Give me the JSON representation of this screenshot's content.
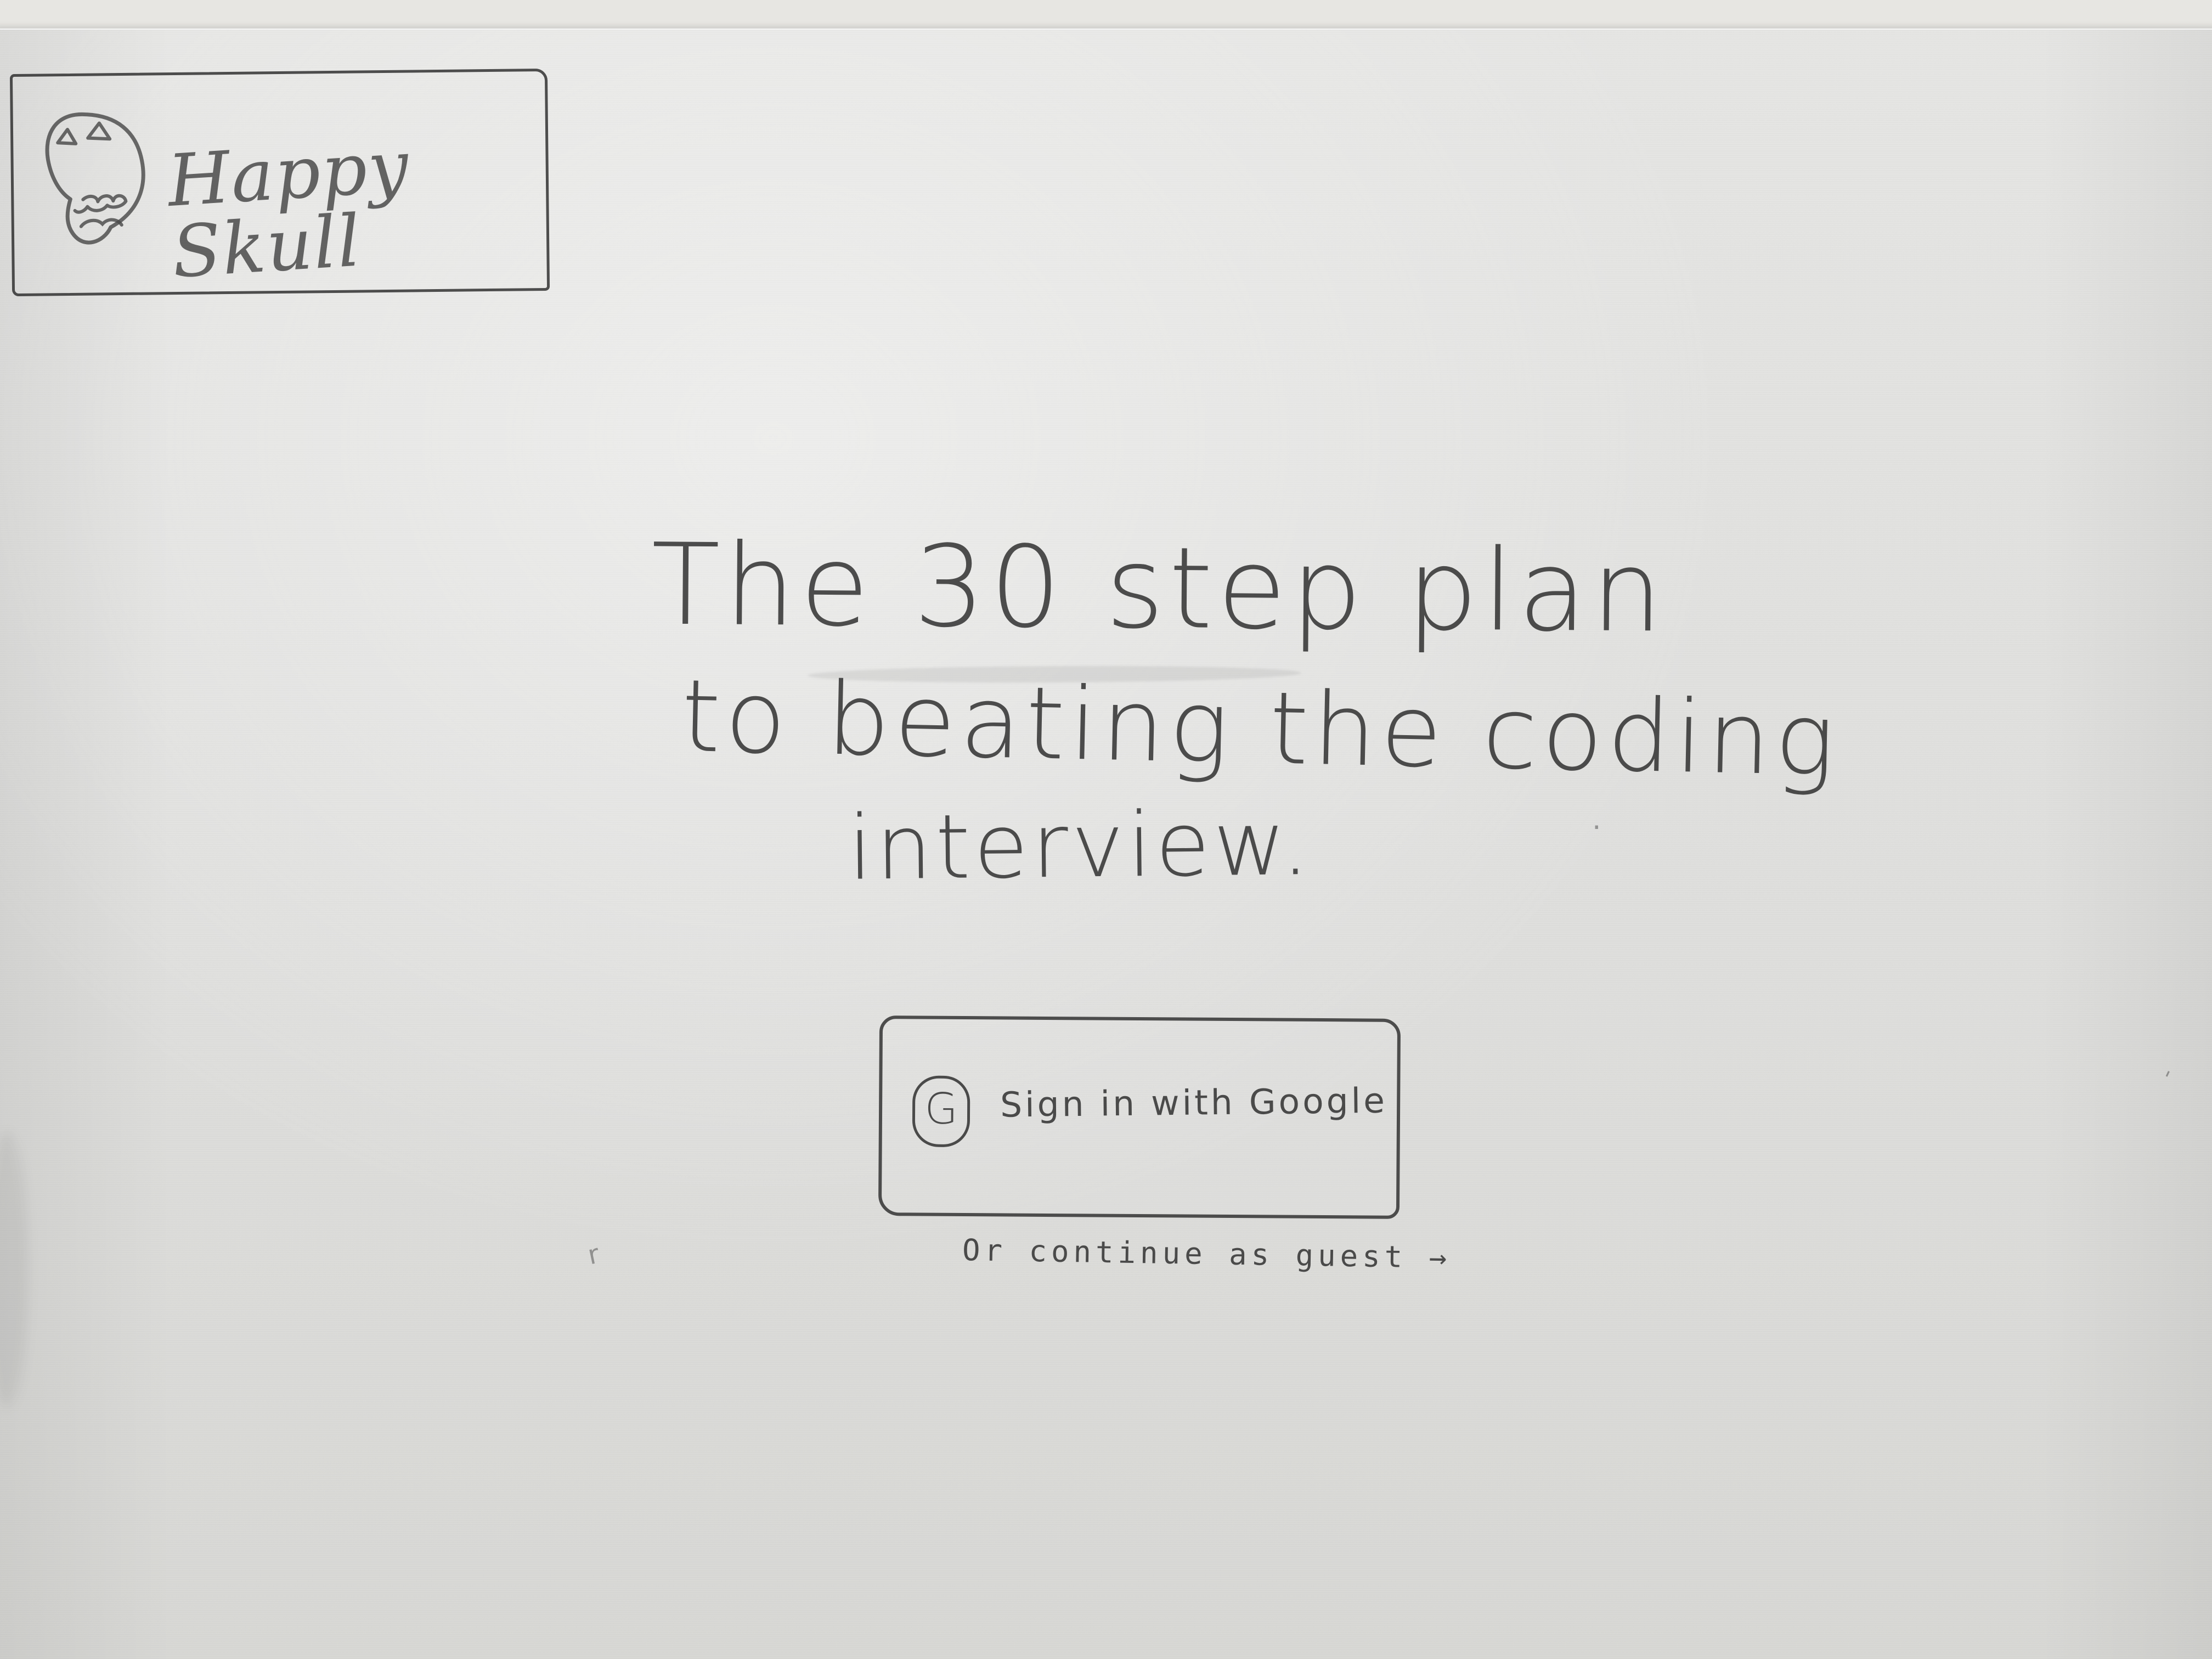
{
  "brand": {
    "name": "Happy Skull",
    "icon": "skull-icon"
  },
  "hero": {
    "line_1": "The 30 step plan",
    "line_2": "to beating the coding",
    "line_3": "interview."
  },
  "auth": {
    "google_icon_letter": "G",
    "google_button_label": "Sign in with Google",
    "guest_link_label": "Or continue as guest",
    "guest_arrow": "→"
  },
  "stray_marks": {
    "left_mark": "r",
    "right_mark": "'",
    "right_dot": "."
  }
}
